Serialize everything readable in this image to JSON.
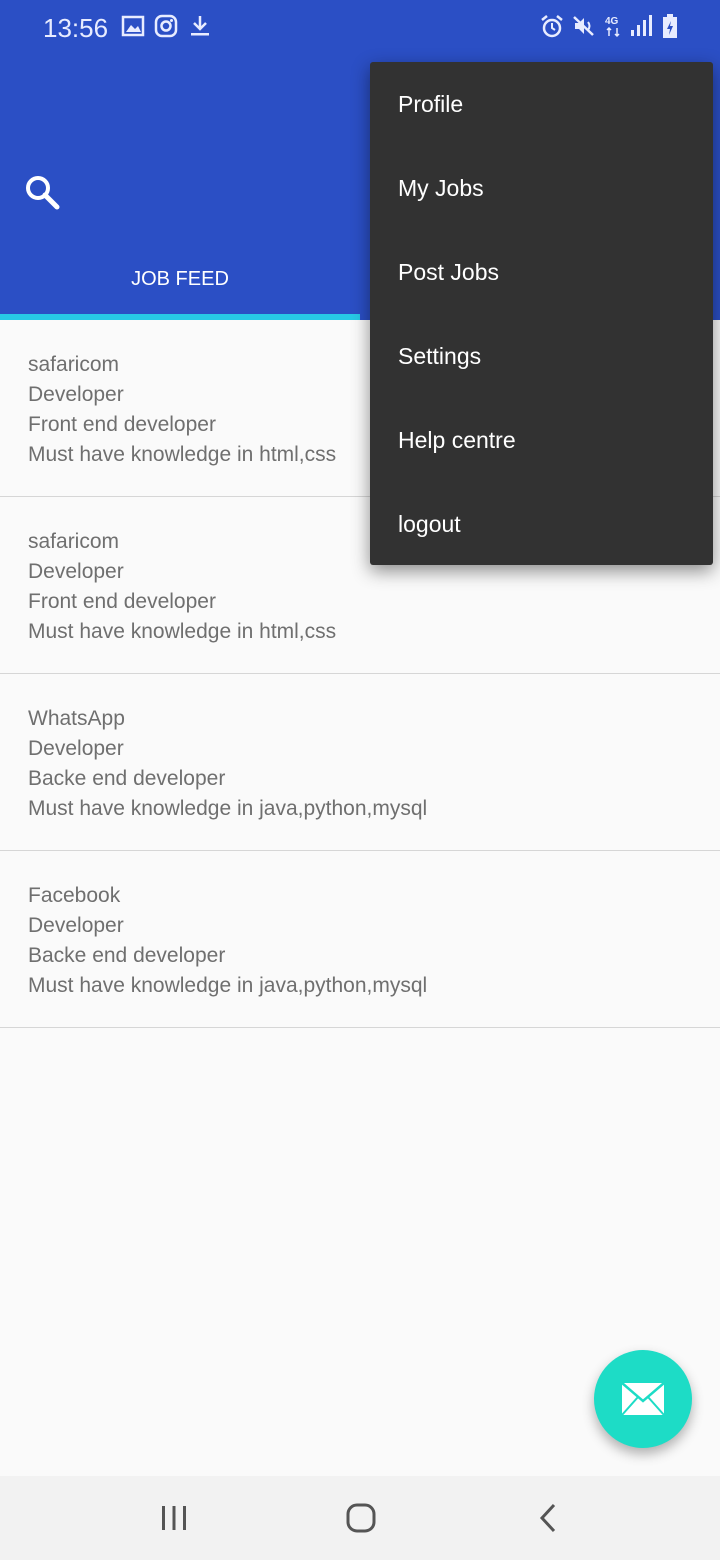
{
  "status_bar": {
    "time": "13:56",
    "icons": [
      "image-icon",
      "instagram-icon",
      "download-icon",
      "alarm-icon",
      "mute-icon",
      "network-4g-icon",
      "signal-icon",
      "battery-icon"
    ]
  },
  "app_bar": {
    "color": "#2b4fc5",
    "search_icon": "search-icon"
  },
  "tabs": [
    {
      "label": "JOB FEED",
      "selected": true
    }
  ],
  "jobs": [
    {
      "company": "safaricom",
      "role": "Developer",
      "title": "Front end developer",
      "requirements": "Must have knowledge in html,css"
    },
    {
      "company": "safaricom",
      "role": "Developer",
      "title": "Front end developer",
      "requirements": "Must have knowledge in html,css"
    },
    {
      "company": "WhatsApp",
      "role": "Developer",
      "title": "Backe end developer",
      "requirements": "Must have knowledge in java,python,mysql"
    },
    {
      "company": "Facebook",
      "role": "Developer",
      "title": "Backe end developer",
      "requirements": "Must have knowledge in java,python,mysql"
    }
  ],
  "menu": {
    "items": [
      "Profile",
      "My Jobs",
      "Post Jobs",
      "Settings",
      "Help centre",
      "logout"
    ]
  },
  "fab": {
    "icon": "mail-icon",
    "color": "#1ddcc6"
  },
  "nav_bar": {
    "icons": [
      "recents-icon",
      "home-icon",
      "back-icon"
    ]
  }
}
